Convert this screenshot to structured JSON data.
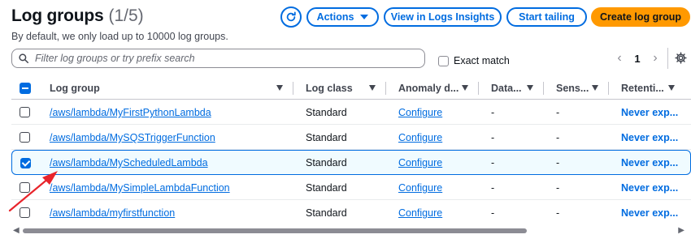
{
  "header": {
    "title": "Log groups",
    "count": "(1/5)",
    "subtitle": "By default, we only load up to 10000 log groups."
  },
  "toolbar": {
    "refresh_icon": "refresh-icon",
    "actions_label": "Actions",
    "insights_label": "View in Logs Insights",
    "tail_label": "Start tailing",
    "create_label": "Create log group"
  },
  "search": {
    "placeholder": "Filter log groups or try prefix search",
    "value": ""
  },
  "exact_match": {
    "label": "Exact match",
    "checked": false
  },
  "pagination": {
    "prev": "‹",
    "page": "1",
    "next": "›"
  },
  "table": {
    "columns": [
      "Log group",
      "Log class",
      "Anomaly d...",
      "Data...",
      "Sens...",
      "Retenti..."
    ],
    "rows": [
      {
        "name": "/aws/lambda/MyFirstPythonLambda",
        "log_class": "Standard",
        "anomaly": "Configure",
        "data": "-",
        "sensitive": "-",
        "retention": "Never exp...",
        "selected": false
      },
      {
        "name": "/aws/lambda/MySQSTriggerFunction",
        "log_class": "Standard",
        "anomaly": "Configure",
        "data": "-",
        "sensitive": "-",
        "retention": "Never exp...",
        "selected": false
      },
      {
        "name": "/aws/lambda/MyScheduledLambda",
        "log_class": "Standard",
        "anomaly": "Configure",
        "data": "-",
        "sensitive": "-",
        "retention": "Never exp...",
        "selected": true
      },
      {
        "name": "/aws/lambda/MySimpleLambdaFunction",
        "log_class": "Standard",
        "anomaly": "Configure",
        "data": "-",
        "sensitive": "-",
        "retention": "Never exp...",
        "selected": false
      },
      {
        "name": "/aws/lambda/myfirstfunction",
        "log_class": "Standard",
        "anomaly": "Configure",
        "data": "-",
        "sensitive": "-",
        "retention": "Never exp...",
        "selected": false
      }
    ]
  },
  "colors": {
    "accent": "#006ce0",
    "primary_button": "#ff9900",
    "annotation_arrow": "#e8242b"
  }
}
